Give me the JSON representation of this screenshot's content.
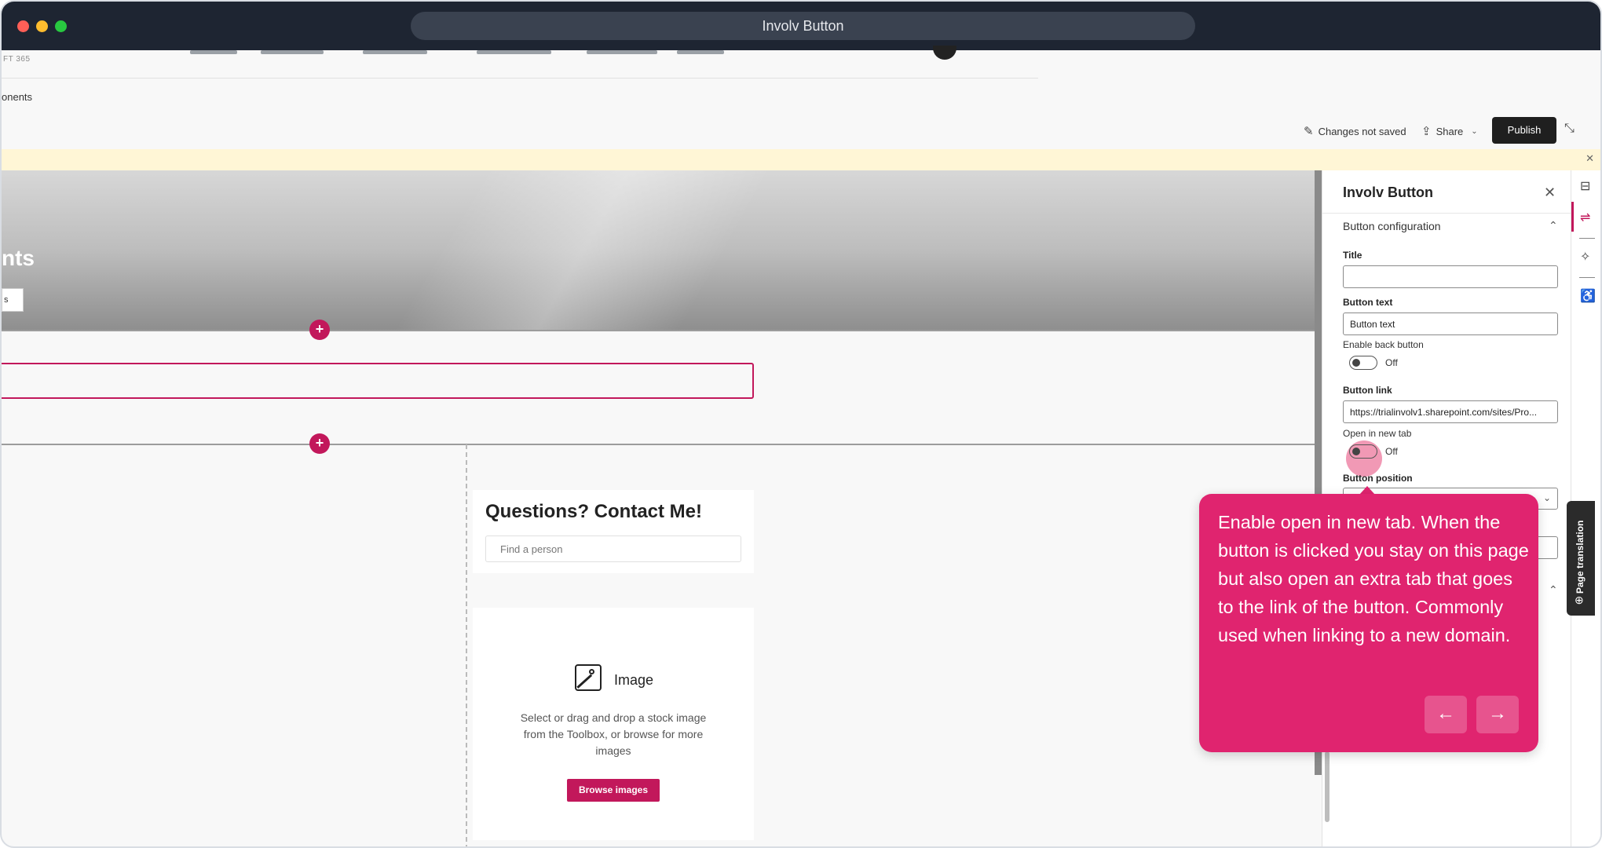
{
  "window": {
    "title": "Involv Button"
  },
  "site": {
    "brand_fragment": "FT 365",
    "breadcrumb_fragment": "onents"
  },
  "toolbar": {
    "unsaved_label": "Changes not saved",
    "share_label": "Share",
    "publish_label": "Publish"
  },
  "canvas": {
    "hero_title_fragment": "nts",
    "hero_button_fragment": "s",
    "contact_title": "Questions? Contact Me!",
    "find_placeholder": "Find a person",
    "image_title": "Image",
    "image_description": "Select or drag and drop a stock image from the Toolbox, or browse for more images",
    "browse_label": "Browse images"
  },
  "panel": {
    "title": "Involv Button",
    "section": "Button configuration",
    "fields": {
      "title_label": "Title",
      "title_value": "",
      "button_text_label": "Button text",
      "button_text_value": "Button text",
      "back_button_label": "Enable back button",
      "back_button_state": "Off",
      "link_label": "Button link",
      "link_value": "https://trialinvolv1.sharepoint.com/sites/Pro...",
      "new_tab_label": "Open in new tab",
      "new_tab_state": "Off",
      "position_label": "Button position"
    }
  },
  "side_tab": {
    "label": "Page translation"
  },
  "tooltip": {
    "text": "Enable open in new tab. When the button is clicked you stay on this page but also open an extra tab that goes to the link of the button. Commonly used when linking to a new domain.",
    "prev_icon": "arrow-left-icon",
    "next_icon": "arrow-right-icon"
  },
  "colors": {
    "accent": "#c2185b",
    "tooltip_bg": "#e0246f",
    "titlebar": "#1e2532",
    "notice": "#fff6d6"
  }
}
